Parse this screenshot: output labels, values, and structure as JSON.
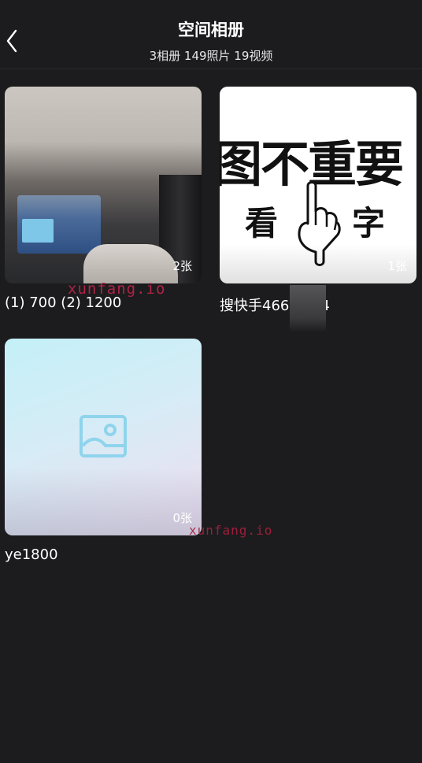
{
  "header": {
    "title": "空间相册",
    "subtitle": "3相册 149照片 19视频"
  },
  "albums": [
    {
      "name": "(1) 700 (2) 1200",
      "count": "2张",
      "cover": "room-photo"
    },
    {
      "name": "搜快手466  8914",
      "count": "1张",
      "cover": "meme-image",
      "meme": {
        "line1": "图不重要",
        "line2_left": "看",
        "line2_right": "字"
      }
    },
    {
      "name": "ye1800",
      "count": "0张",
      "cover": "empty-placeholder"
    }
  ],
  "watermarks": [
    "xunfang.io",
    "xunfang.io"
  ]
}
